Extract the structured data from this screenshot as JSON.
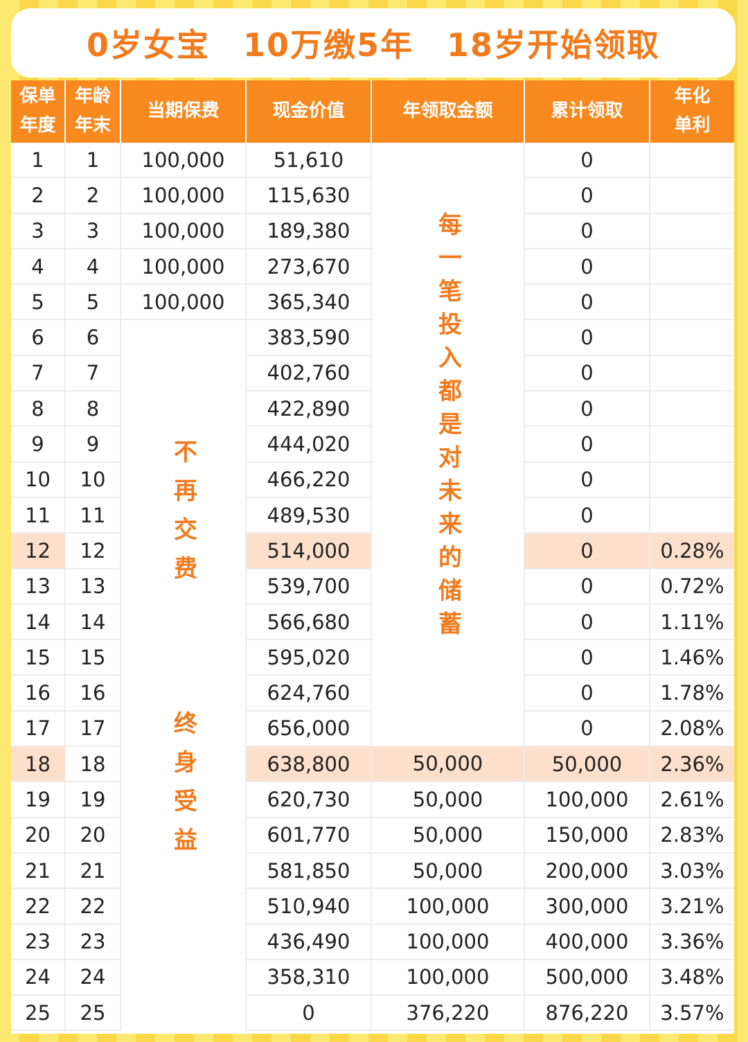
{
  "title": "0岁女宝　10万缴5年　18岁开始领取",
  "headers": {
    "policy_year": [
      "保单",
      "年度"
    ],
    "age": [
      "年龄",
      "年末"
    ],
    "premium": "当期保费",
    "cash_value": "现金价值",
    "annual_payout": "年领取金额",
    "cumulative": "累计领取",
    "simple_rate": [
      "年化",
      "单利"
    ]
  },
  "merged": {
    "premium_col": "不再交费",
    "premium_col_2": "终身受益",
    "payout_col": "每一笔投入都是对未来的储蓄"
  },
  "rows": [
    {
      "year": "1",
      "age": "1",
      "premium": "100,000",
      "cash": "51,610",
      "payout": "",
      "cum": "0",
      "rate": ""
    },
    {
      "year": "2",
      "age": "2",
      "premium": "100,000",
      "cash": "115,630",
      "payout": "",
      "cum": "0",
      "rate": ""
    },
    {
      "year": "3",
      "age": "3",
      "premium": "100,000",
      "cash": "189,380",
      "payout": "",
      "cum": "0",
      "rate": ""
    },
    {
      "year": "4",
      "age": "4",
      "premium": "100,000",
      "cash": "273,670",
      "payout": "",
      "cum": "0",
      "rate": ""
    },
    {
      "year": "5",
      "age": "5",
      "premium": "100,000",
      "cash": "365,340",
      "payout": "",
      "cum": "0",
      "rate": ""
    },
    {
      "year": "6",
      "age": "6",
      "premium": "",
      "cash": "383,590",
      "payout": "",
      "cum": "0",
      "rate": ""
    },
    {
      "year": "7",
      "age": "7",
      "premium": "",
      "cash": "402,760",
      "payout": "",
      "cum": "0",
      "rate": ""
    },
    {
      "year": "8",
      "age": "8",
      "premium": "",
      "cash": "422,890",
      "payout": "",
      "cum": "0",
      "rate": ""
    },
    {
      "year": "9",
      "age": "9",
      "premium": "",
      "cash": "444,020",
      "payout": "",
      "cum": "0",
      "rate": ""
    },
    {
      "year": "10",
      "age": "10",
      "premium": "",
      "cash": "466,220",
      "payout": "",
      "cum": "0",
      "rate": ""
    },
    {
      "year": "11",
      "age": "11",
      "premium": "",
      "cash": "489,530",
      "payout": "",
      "cum": "0",
      "rate": ""
    },
    {
      "year": "12",
      "age": "12",
      "premium": "",
      "cash": "514,000",
      "payout": "",
      "cum": "0",
      "rate": "0.28%",
      "highlight": true
    },
    {
      "year": "13",
      "age": "13",
      "premium": "",
      "cash": "539,700",
      "payout": "",
      "cum": "0",
      "rate": "0.72%"
    },
    {
      "year": "14",
      "age": "14",
      "premium": "",
      "cash": "566,680",
      "payout": "",
      "cum": "0",
      "rate": "1.11%"
    },
    {
      "year": "15",
      "age": "15",
      "premium": "",
      "cash": "595,020",
      "payout": "",
      "cum": "0",
      "rate": "1.46%"
    },
    {
      "year": "16",
      "age": "16",
      "premium": "",
      "cash": "624,760",
      "payout": "",
      "cum": "0",
      "rate": "1.78%"
    },
    {
      "year": "17",
      "age": "17",
      "premium": "",
      "cash": "656,000",
      "payout": "",
      "cum": "0",
      "rate": "2.08%"
    },
    {
      "year": "18",
      "age": "18",
      "premium": "",
      "cash": "638,800",
      "payout": "50,000",
      "cum": "50,000",
      "rate": "2.36%",
      "highlight": true
    },
    {
      "year": "19",
      "age": "19",
      "premium": "",
      "cash": "620,730",
      "payout": "50,000",
      "cum": "100,000",
      "rate": "2.61%"
    },
    {
      "year": "20",
      "age": "20",
      "premium": "",
      "cash": "601,770",
      "payout": "50,000",
      "cum": "150,000",
      "rate": "2.83%"
    },
    {
      "year": "21",
      "age": "21",
      "premium": "",
      "cash": "581,850",
      "payout": "50,000",
      "cum": "200,000",
      "rate": "3.03%"
    },
    {
      "year": "22",
      "age": "22",
      "premium": "",
      "cash": "510,940",
      "payout": "100,000",
      "cum": "300,000",
      "rate": "3.21%"
    },
    {
      "year": "23",
      "age": "23",
      "premium": "",
      "cash": "436,490",
      "payout": "100,000",
      "cum": "400,000",
      "rate": "3.36%"
    },
    {
      "year": "24",
      "age": "24",
      "premium": "",
      "cash": "358,310",
      "payout": "100,000",
      "cum": "500,000",
      "rate": "3.48%"
    },
    {
      "year": "25",
      "age": "25",
      "premium": "",
      "cash": "0",
      "payout": "376,220",
      "cum": "876,220",
      "rate": "3.57%"
    }
  ],
  "colors": {
    "header_bg": "#f7891f",
    "accent_text": "#f07a1c",
    "highlight_row": "#fde0cc",
    "frame": "#fce55a"
  }
}
